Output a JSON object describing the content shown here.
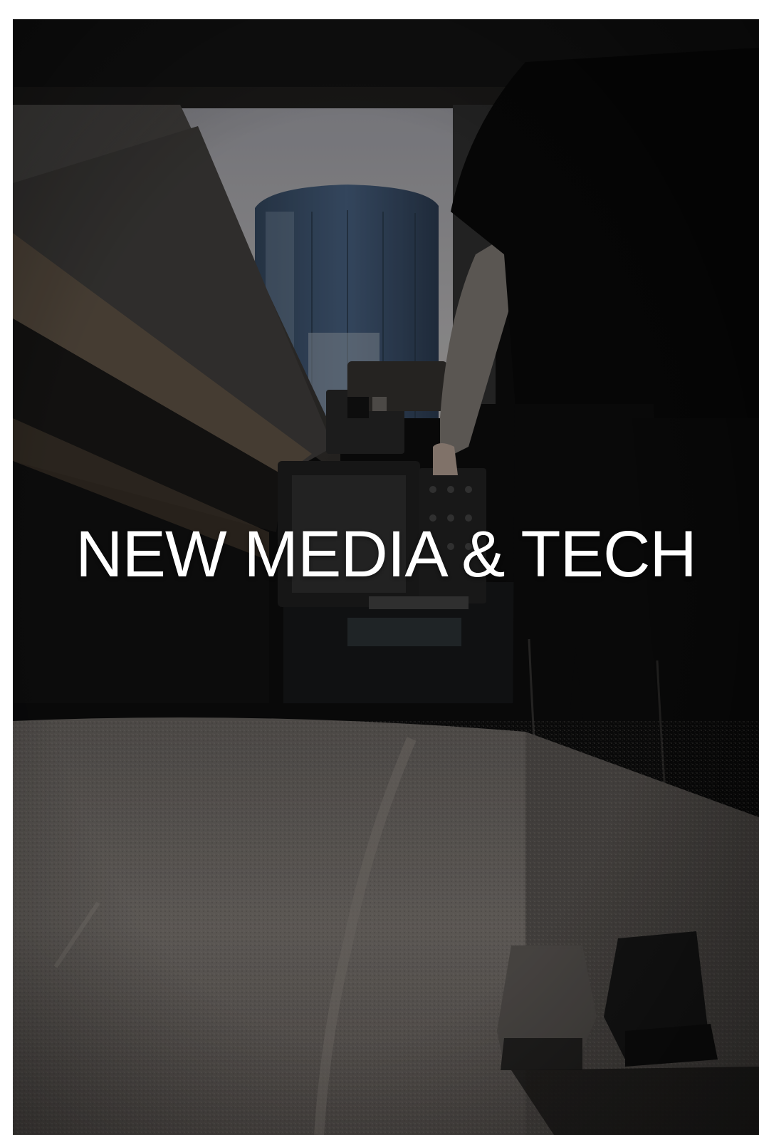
{
  "hero": {
    "headline": "NEW MEDIA & TECH"
  },
  "colors": {
    "page_background": "#ffffff",
    "overlay_text": "#ffffff",
    "photo_dark": "#0b0b0c"
  }
}
